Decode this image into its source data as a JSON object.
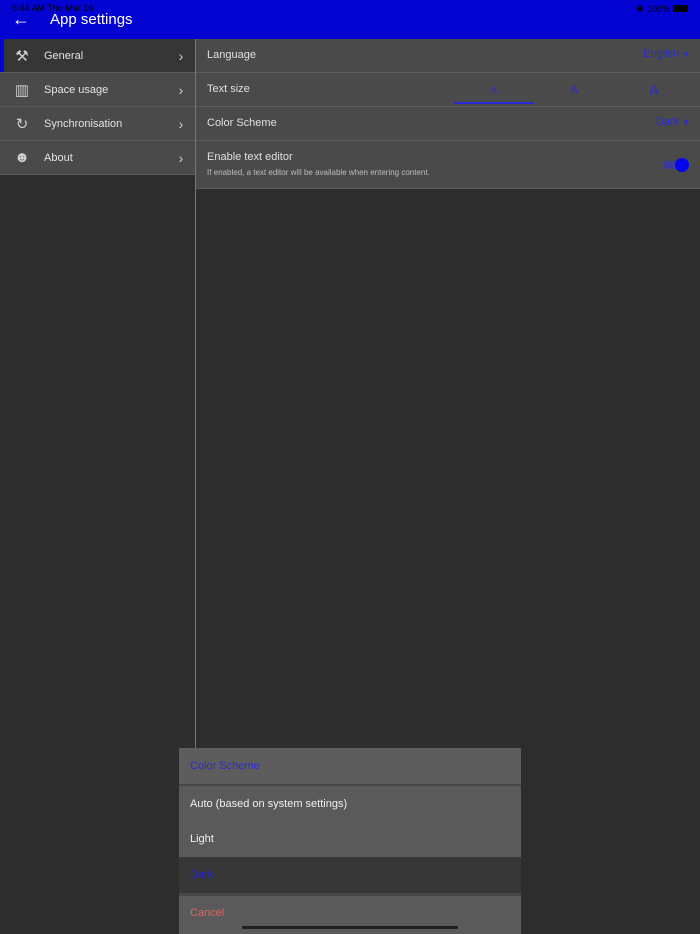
{
  "status_bar": {
    "time": "6:44 AM   Thu Mar 16",
    "battery": "100%"
  },
  "header": {
    "back_icon": "arrow-left-icon",
    "title": "App settings"
  },
  "sidebar": {
    "items": [
      {
        "label": "General",
        "icon": "tools-icon",
        "active": true
      },
      {
        "label": "Space usage",
        "icon": "bar-chart-icon",
        "active": false
      },
      {
        "label": "Synchronisation",
        "icon": "sync-icon",
        "active": false
      },
      {
        "label": "About",
        "icon": "people-icon",
        "active": false
      }
    ]
  },
  "settings": {
    "language": {
      "label": "Language",
      "value": "English"
    },
    "text_size": {
      "label": "Text size",
      "options": [
        "A",
        "A",
        "A"
      ],
      "selected_index": 0
    },
    "color_scheme": {
      "label": "Color Scheme",
      "value": "Dark"
    },
    "text_editor": {
      "label": "Enable text editor",
      "description": "If enabled, a text editor will be available when entering content.",
      "enabled": true
    }
  },
  "action_sheet": {
    "title": "Color Scheme",
    "options": [
      "Auto (based on system settings)",
      "Light",
      "Dark"
    ],
    "selected": "Dark",
    "cancel": "Cancel"
  },
  "colors": {
    "accent": "#0303d2",
    "link": "#2a2ad8",
    "cancel": "#e06464",
    "background": "#2d2d2d"
  }
}
